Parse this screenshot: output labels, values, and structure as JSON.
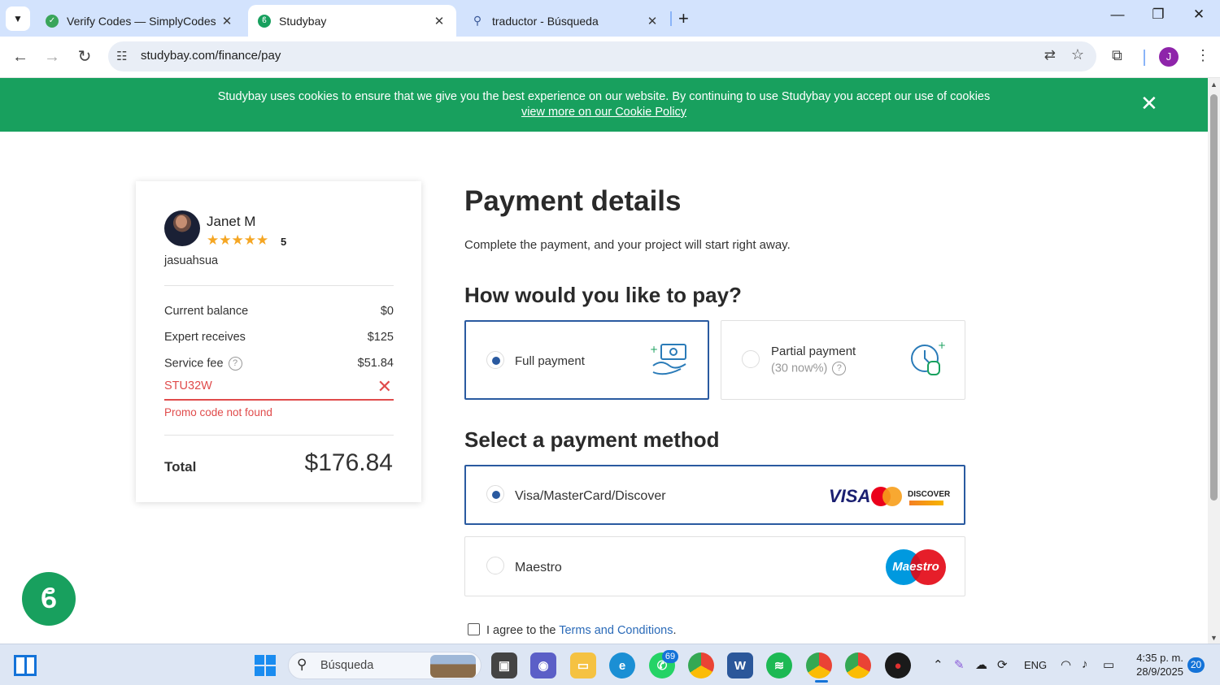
{
  "browser": {
    "tabs": [
      {
        "title": "Verify Codes — SimplyCodes",
        "favicon_color": "#3aa55a"
      },
      {
        "title": "Studybay",
        "favicon_color": "#18a05e"
      },
      {
        "title": "traductor - Búsqueda",
        "favicon": "search-icon"
      }
    ],
    "url": "studybay.com/finance/pay",
    "profile_initial": "J"
  },
  "cookie_banner": {
    "text": "Studybay uses cookies to ensure that we give you the best experience on our website. By continuing to use Studybay you accept our use of cookies",
    "link": "view more on our Cookie Policy"
  },
  "summary": {
    "expert_name": "Janet M",
    "stars": "★★★★★",
    "rating": "5",
    "username": "jasuahsua",
    "rows": [
      {
        "label": "Current balance",
        "value": "$0"
      },
      {
        "label": "Expert receives",
        "value": "$125"
      },
      {
        "label": "Service fee",
        "value": "$51.84",
        "help": "?"
      }
    ],
    "promo_code": "STU32W",
    "promo_error": "Promo code not found",
    "total_label": "Total",
    "total_value": "$176.84"
  },
  "payment": {
    "title": "Payment details",
    "subtitle": "Complete the payment, and your project will start right away.",
    "how_heading": "How would you like to pay?",
    "plans": [
      {
        "label": "Full payment",
        "selected": true
      },
      {
        "label": "Partial payment",
        "sub": "(30 now%)",
        "selected": false
      }
    ],
    "method_heading": "Select a payment method",
    "methods": [
      {
        "label": "Visa/MasterCard/Discover",
        "selected": true,
        "logo_visa": "VISA",
        "logo_discover": "DISCOVER"
      },
      {
        "label": "Maestro",
        "selected": false,
        "logo": "Maestro"
      }
    ],
    "terms_prefix": "I agree to the",
    "terms_link": "Terms and Conditions",
    "terms_suffix": "."
  },
  "taskbar": {
    "search_placeholder": "Búsqueda",
    "whatsapp_badge": "69",
    "lang": "ENG",
    "time": "4:35 p. m.",
    "date": "28/9/2025",
    "notifications": "20"
  },
  "colors": {
    "brand_green": "#18a05e",
    "accent_blue": "#2a5aa0",
    "error_red": "#e04b4b"
  }
}
